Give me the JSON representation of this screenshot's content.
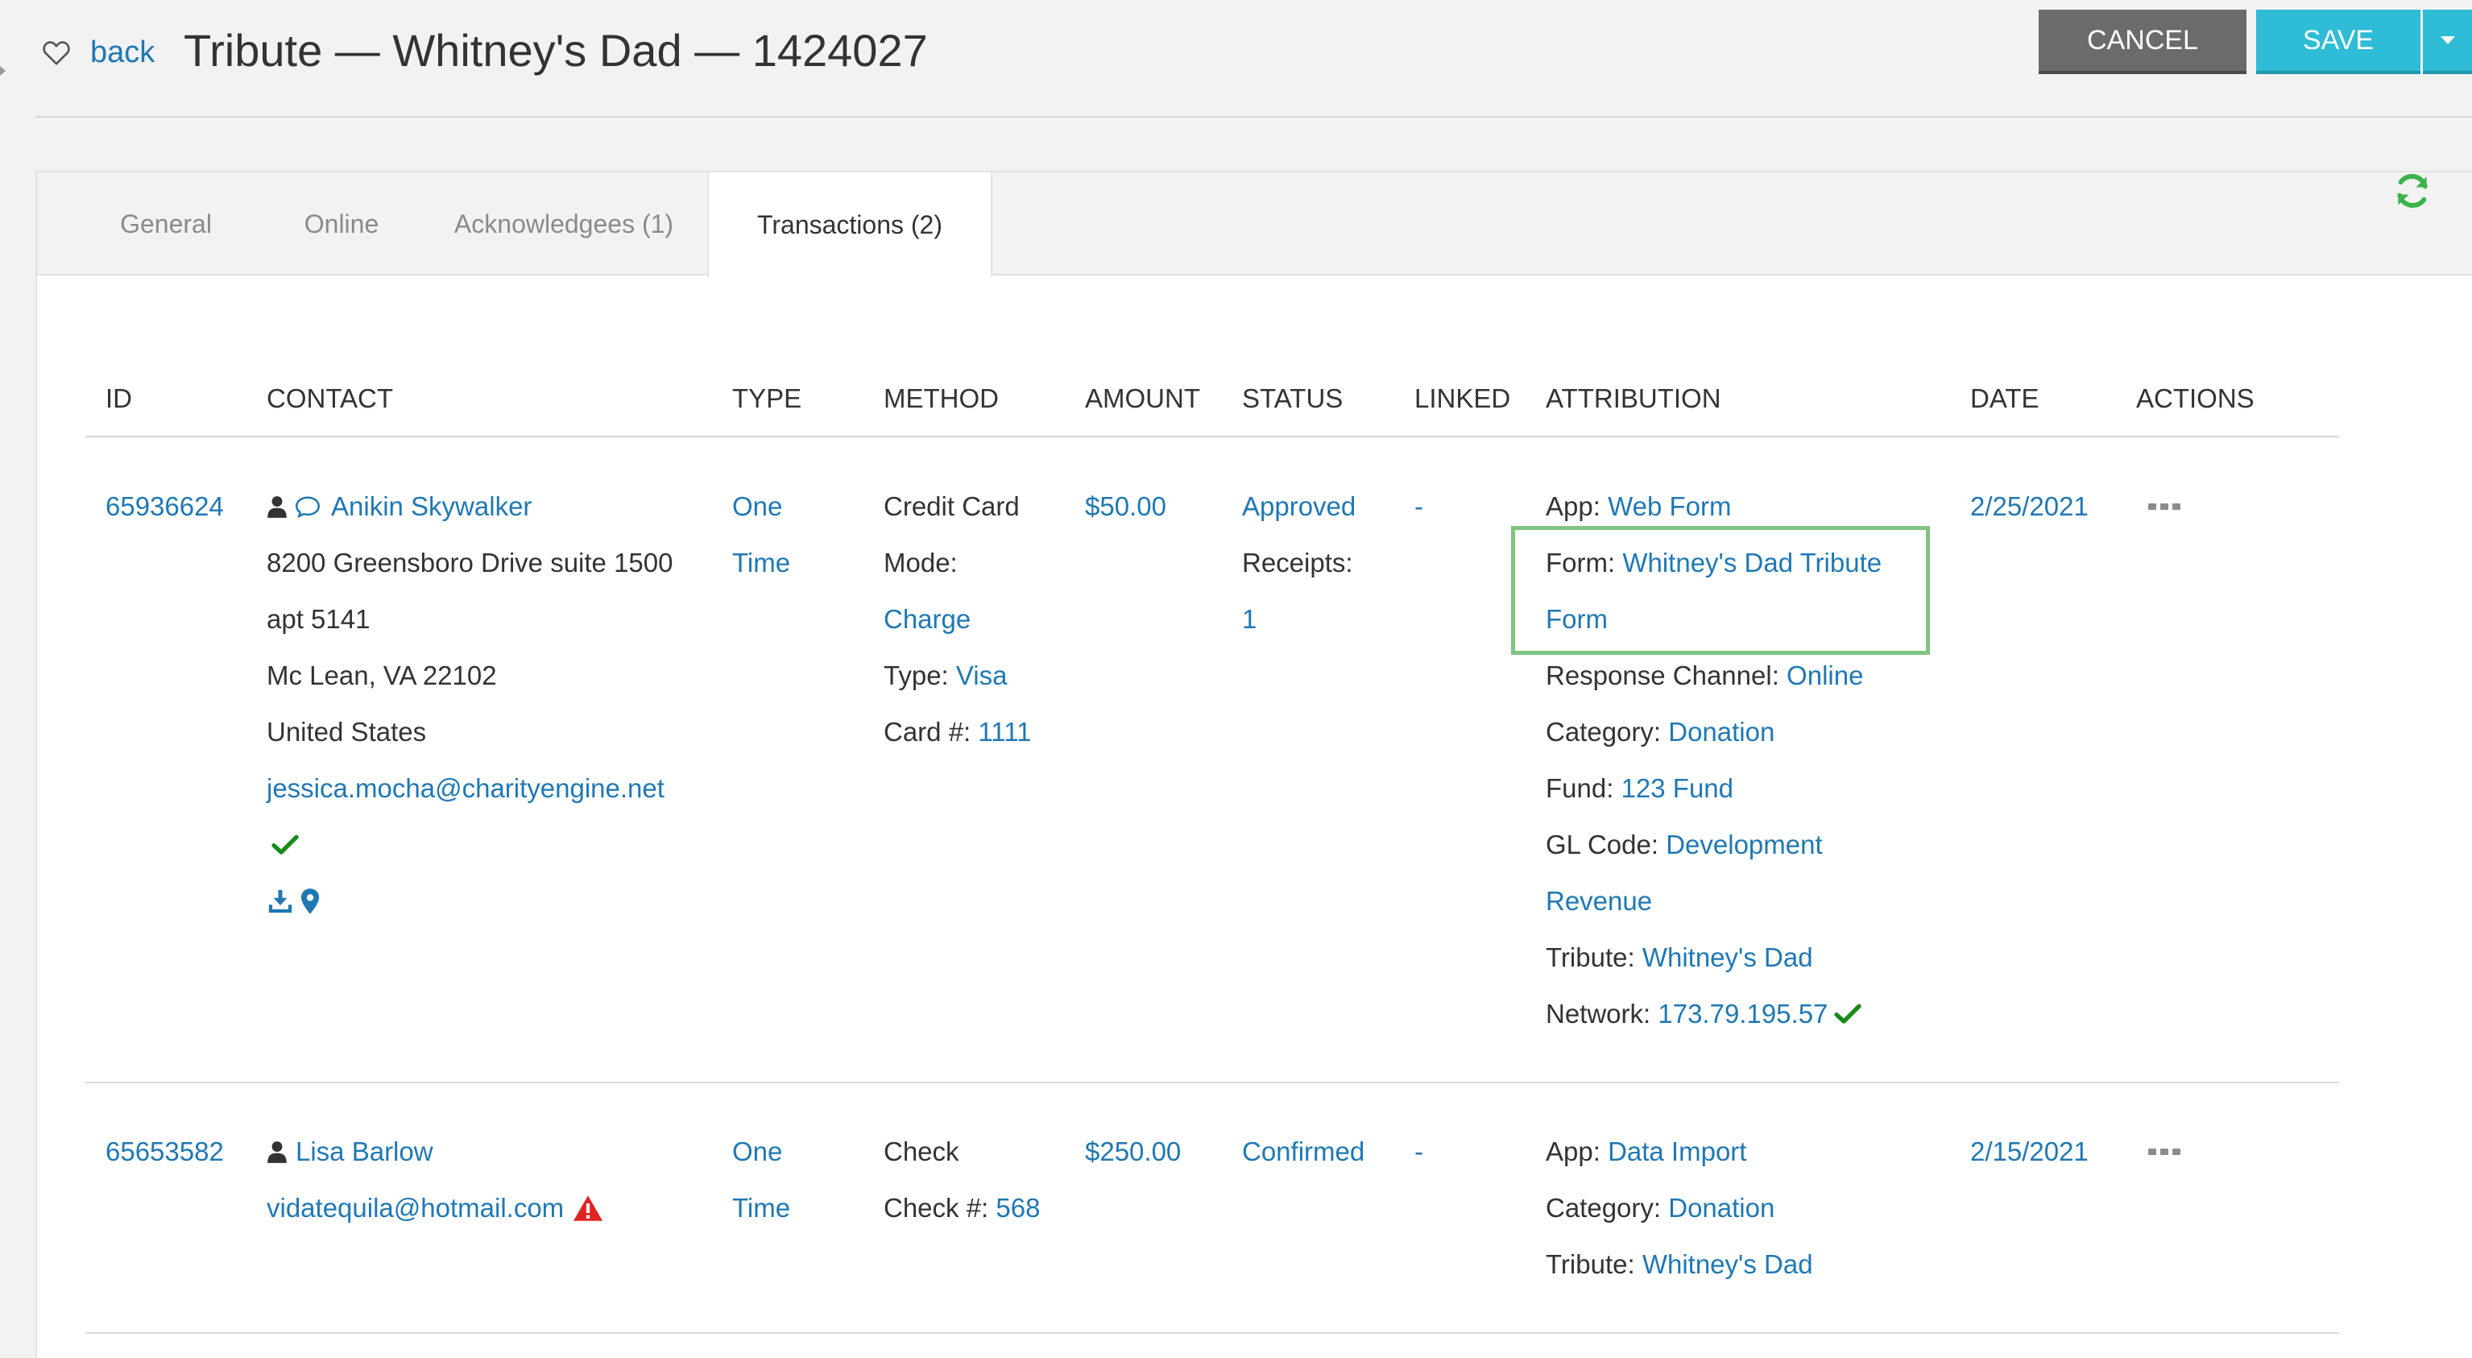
{
  "header": {
    "back_label": "back",
    "title": "Tribute — Whitney's Dad — 1424027",
    "cancel_label": "CANCEL",
    "save_label": "SAVE"
  },
  "tabs": [
    {
      "label": "General",
      "active": false
    },
    {
      "label": "Online",
      "active": false
    },
    {
      "label": "Acknowledgees (1)",
      "active": false
    },
    {
      "label": "Transactions (2)",
      "active": true
    }
  ],
  "table": {
    "columns": [
      "ID",
      "CONTACT",
      "TYPE",
      "METHOD",
      "AMOUNT",
      "STATUS",
      "LINKED",
      "ATTRIBUTION",
      "DATE",
      "ACTIONS"
    ],
    "rows": [
      {
        "id": "65936624",
        "contact_name": "Anikin Skywalker",
        "address_1": "8200 Greensboro Drive suite 1500",
        "address_2": "apt 5141",
        "city_state_zip": "Mc Lean, VA 22102",
        "country": "United States",
        "email": "jessica.mocha@charityengine.net",
        "email_verified": true,
        "type_line1": "One",
        "type_line2": "Time",
        "method": {
          "name": "Credit Card",
          "mode_label": "Mode:",
          "mode_value": "Charge",
          "type_label": "Type:",
          "type_value": "Visa",
          "card_label": "Card #:",
          "card_value": "1111"
        },
        "amount": "$50.00",
        "status": "Approved",
        "receipts_label": "Receipts:",
        "receipts_value": "1",
        "linked": "-",
        "attribution": {
          "app_label": "App:",
          "app_value": "Web Form",
          "form_label": "Form:",
          "form_value_1": "Whitney's Dad Tribute",
          "form_value_2": "Form",
          "channel_label": "Response Channel:",
          "channel_value": "Online",
          "category_label": "Category:",
          "category_value": "Donation",
          "fund_label": "Fund:",
          "fund_value": "123 Fund",
          "gl_label": "GL Code:",
          "gl_value_1": "Development",
          "gl_value_2": "Revenue",
          "tribute_label": "Tribute:",
          "tribute_value": "Whitney's Dad",
          "network_label": "Network:",
          "network_value": "173.79.195.57"
        },
        "date": "2/25/2021"
      },
      {
        "id": "65653582",
        "contact_name": "Lisa Barlow",
        "email": "vidatequila@hotmail.com",
        "email_warning": true,
        "type_line1": "One",
        "type_line2": "Time",
        "method": {
          "name": "Check",
          "check_label": "Check #:",
          "check_value": "568"
        },
        "amount": "$250.00",
        "status": "Confirmed",
        "linked": "-",
        "attribution": {
          "app_label": "App:",
          "app_value": "Data Import",
          "category_label": "Category:",
          "category_value": "Donation",
          "tribute_label": "Tribute:",
          "tribute_value": "Whitney's Dad"
        },
        "date": "2/15/2021"
      }
    ]
  },
  "colors": {
    "link": "#1f78b4",
    "save_button": "#2ebcd6",
    "cancel_button": "#6b6b6b",
    "highlight_border": "#7fc47f",
    "success": "#1a8a1a",
    "warning": "#e02424",
    "refresh": "#3cb34a"
  },
  "icons": [
    "heart-icon",
    "user-icon",
    "chat-icon",
    "check-icon",
    "download-icon",
    "map-pin-icon",
    "warning-icon",
    "more-dots-icon",
    "refresh-icon",
    "chevron-down-icon"
  ]
}
